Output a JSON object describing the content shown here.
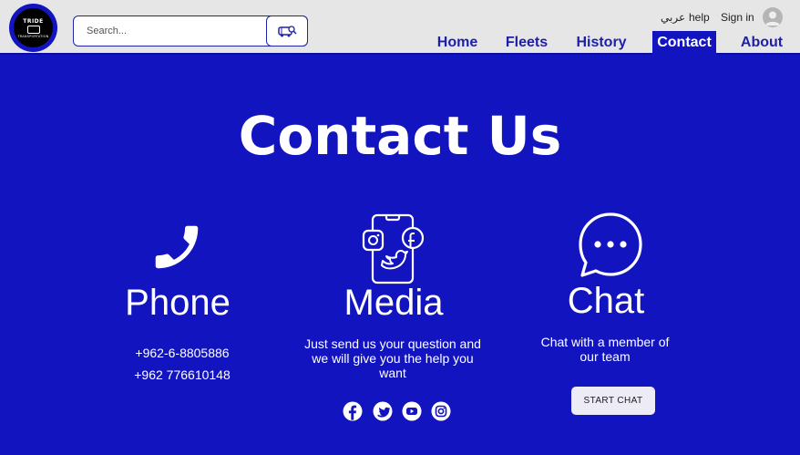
{
  "header": {
    "logo": {
      "top_text": "TRIDE",
      "bottom_text": "TRANSPORTATION"
    },
    "search": {
      "placeholder": "Search...",
      "value": "",
      "button_icon": "bus-search-icon"
    },
    "utility": {
      "arabic_label": "عربي",
      "help_label": "help",
      "signin_label": "Sign in",
      "avatar_icon": "user-avatar-icon"
    },
    "nav": [
      {
        "label": "Home",
        "active": false
      },
      {
        "label": "Fleets",
        "active": false
      },
      {
        "label": "History",
        "active": false
      },
      {
        "label": "Contact",
        "active": true
      },
      {
        "label": "About",
        "active": false
      }
    ]
  },
  "page": {
    "title": "Contact Us",
    "phone": {
      "icon": "phone-icon",
      "title": "Phone",
      "numbers": [
        "+962-6-8805886",
        "+962 776610148"
      ]
    },
    "media": {
      "icon": "social-media-phone-icon",
      "title": "Media",
      "text": "Just send us your question and we will give you the help you want",
      "socials": [
        "facebook-icon",
        "twitter-icon",
        "youtube-icon",
        "instagram-icon"
      ]
    },
    "chat": {
      "icon": "chat-bubble-icon",
      "title": "Chat",
      "text": "Chat with a member of our team",
      "button_label": "START CHAT"
    }
  },
  "colors": {
    "primary": "#1214c0",
    "header_bg": "#e6e6e6",
    "nav_text": "#1d1fa9",
    "button_bg": "#ecebf6"
  }
}
